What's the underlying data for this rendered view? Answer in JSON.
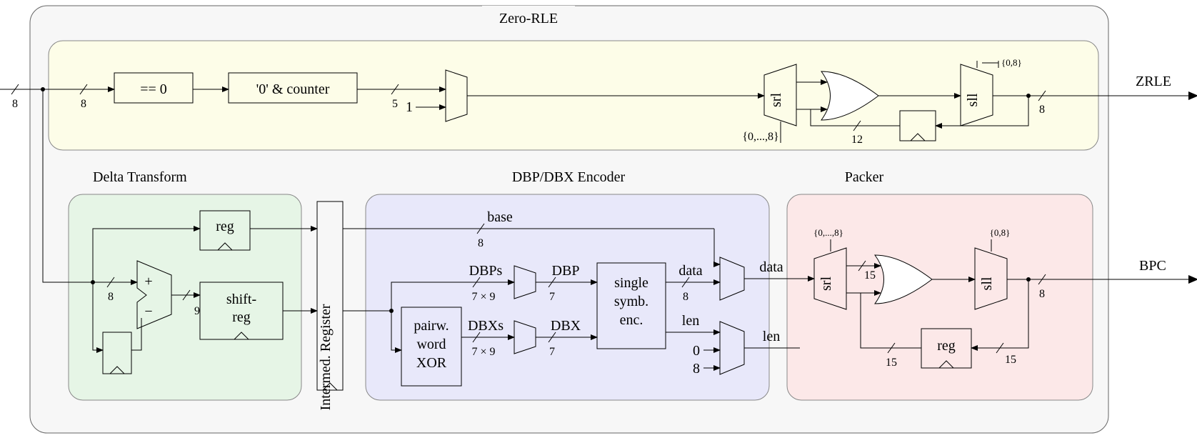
{
  "outer": {
    "title_zrle": "Zero-RLE",
    "out_zrle": "ZRLE",
    "out_bpc": "BPC"
  },
  "zrle": {
    "eq0": "== 0",
    "counter": "'0' & counter",
    "one": "1",
    "srl": "srl",
    "sll": "sll",
    "shift_dn": "{0,...,8}",
    "shift_up": "{0,8}",
    "w_in": "8",
    "w_in2": "8",
    "w_mid": "5",
    "w_fb": "12",
    "w_out": "8"
  },
  "delta": {
    "title": "Delta Transform",
    "reg": "reg",
    "shiftreg": "shift-\nreg",
    "plus": "+",
    "minus": "−",
    "w_in": "8",
    "w_out": "9"
  },
  "intermed": "Intermed. Register",
  "dbp": {
    "title": "DBP/DBX Encoder",
    "base": "base",
    "w_base": "8",
    "dbps": "DBPs",
    "w_dbps": "7 × 9",
    "dbp_out": "DBP",
    "w_dbp": "7",
    "pairwise": "pairw.\nword\nXOR",
    "dbxs": "DBXs",
    "w_dbxs": "7 × 9",
    "dbx_out": "DBX",
    "w_dbx": "7",
    "single": "single\nsymb.\nenc.",
    "data": "data",
    "w_data": "8",
    "len": "len",
    "zero": "0",
    "eight": "8",
    "data2": "data",
    "len2": "len"
  },
  "packer": {
    "title": "Packer",
    "srl": "srl",
    "sll": "sll",
    "shift_dn": "{0,...,8}",
    "shift_up": "{0,8}",
    "reg": "reg",
    "w_mid": "15",
    "w_fb": "15",
    "w_fb2": "15",
    "w_out": "8"
  }
}
